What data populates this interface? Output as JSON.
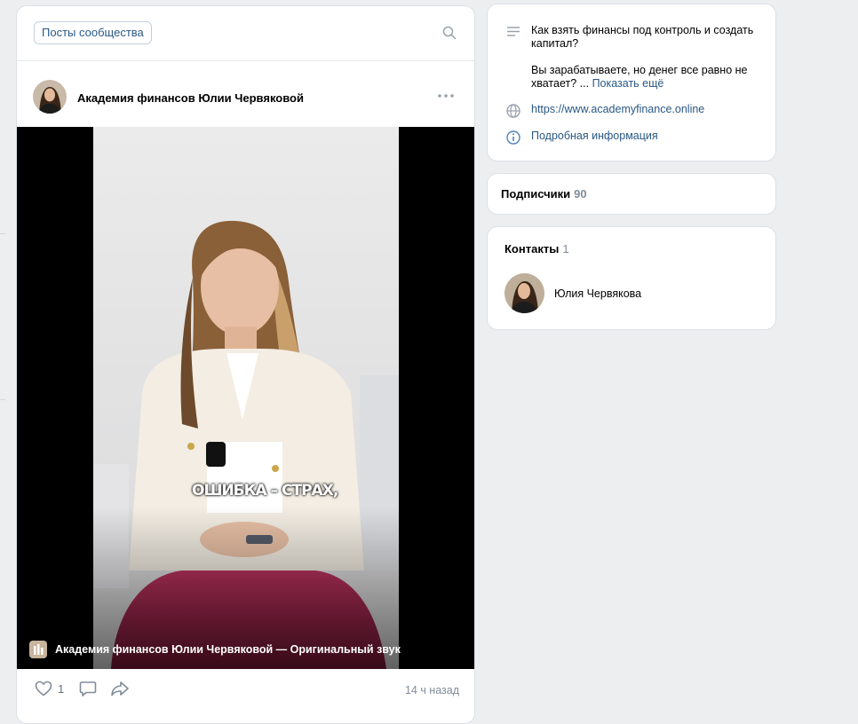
{
  "colors": {
    "accent": "#2a5885",
    "background": "#edeef0",
    "muted": "#818c99"
  },
  "posts": {
    "tab_label": "Посты сообщества",
    "search_icon": "search-icon",
    "post": {
      "author": "Академия финансов Юлии Червяковой",
      "video_subtitle": "ОШИБКА – СТРАХ,",
      "audio_label": "Академия финансов Юлии Червяковой — Оригинальный звук",
      "likes": "1",
      "time": "14 ч назад"
    }
  },
  "info": {
    "description": "Как взять финансы под контроль и создать капитал?",
    "description_more": "Вы зарабатываете, но денег все равно не хватает? ...",
    "show_more": "Показать ещё",
    "website": "https://www.academyfinance.online",
    "details": "Подробная информация"
  },
  "subscribers": {
    "label": "Подписчики",
    "count": "90"
  },
  "contacts": {
    "label": "Контакты",
    "count": "1",
    "items": [
      {
        "name": "Юлия Червякова"
      }
    ]
  }
}
